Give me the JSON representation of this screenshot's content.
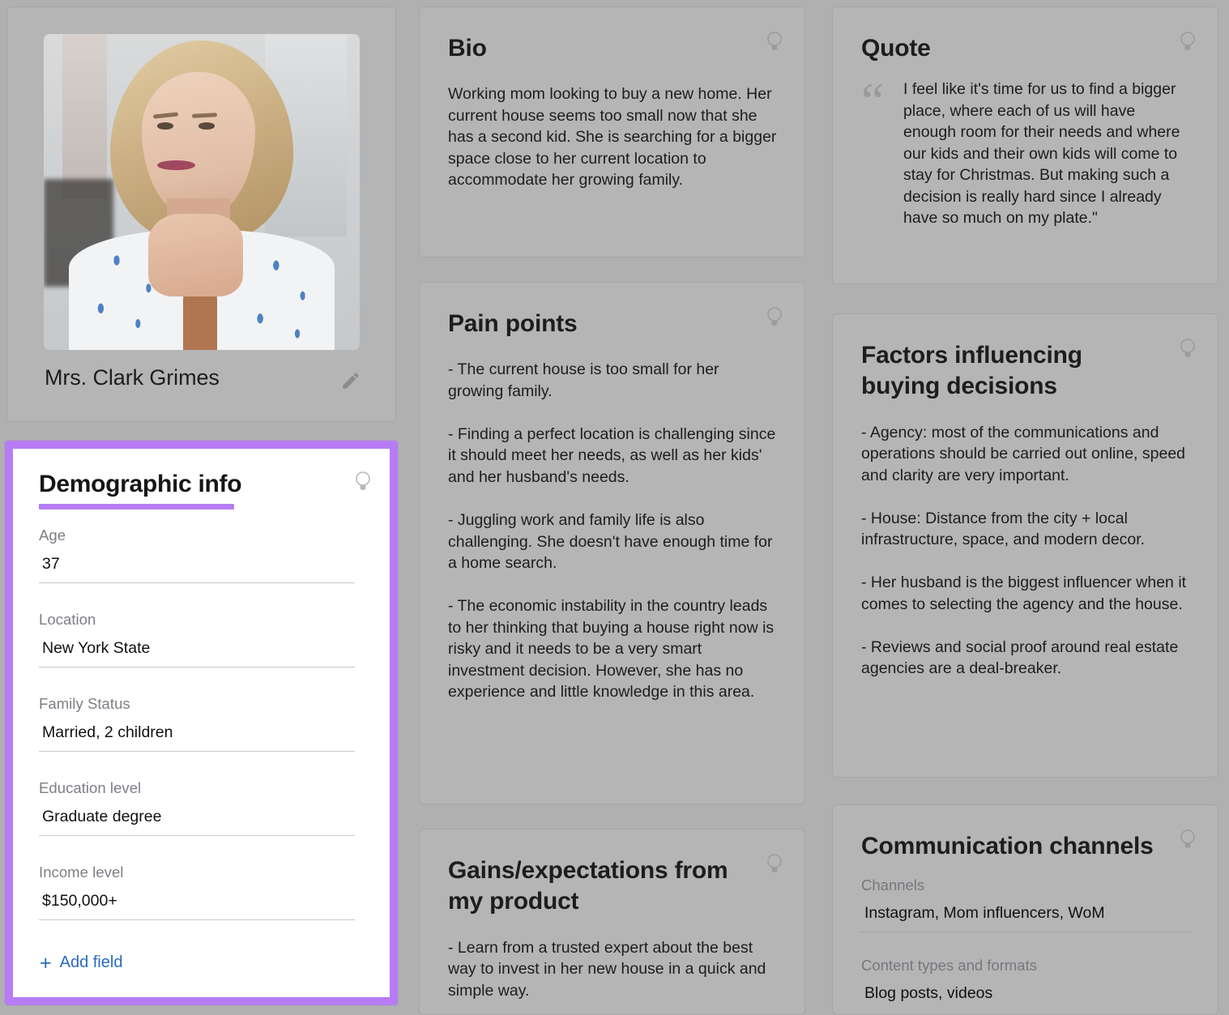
{
  "theme": {
    "page_background": "#b0b0b0",
    "card_background": "#b5b5b5",
    "highlight_purple": "#b77cf5",
    "link_blue": "#2a6bbd"
  },
  "profile": {
    "name": "Mrs. Clark Grimes",
    "photo_alt": "Blonde woman in white floral blouse resting chin on hands",
    "edit_icon": "pencil-icon"
  },
  "demographic": {
    "title": "Demographic info",
    "hint_icon": "lightbulb-icon",
    "fields": [
      {
        "label": "Age",
        "value": "37"
      },
      {
        "label": "Location",
        "value": "New York State"
      },
      {
        "label": "Family Status",
        "value": "Married, 2 children"
      },
      {
        "label": "Education level",
        "value": "Graduate degree"
      },
      {
        "label": "Income level",
        "value": "$150,000+"
      }
    ],
    "add_field_label": "Add field",
    "add_field_icon": "plus-icon"
  },
  "bio": {
    "title": "Bio",
    "hint_icon": "lightbulb-icon",
    "text": "Working mom looking to buy a new home. Her current house seems too small now that she has a second kid. She is searching for a bigger space close to her current location to accommodate her growing family."
  },
  "pain_points": {
    "title": "Pain points",
    "hint_icon": "lightbulb-icon",
    "text": "- The current house is too small for her growing family.\n\n- Finding a perfect location is challenging since it should meet her needs, as well as her kids' and her husband's needs.\n\n- Juggling work and family life is also challenging. She doesn't have enough time for a home search.\n\n- The economic instability in the country leads to her thinking that buying a house right now is risky and it needs to be a very smart investment decision. However, she has no experience and little knowledge in this area."
  },
  "gains": {
    "title": "Gains/expectations from my product",
    "hint_icon": "lightbulb-icon",
    "text": "- Learn from a trusted expert about the best way to invest in her new house in a quick and simple way."
  },
  "quote": {
    "title": "Quote",
    "hint_icon": "lightbulb-icon",
    "quote_mark": "“",
    "text": "I feel like it's time for us to find a bigger place, where each of us will have enough room for their needs and where our kids and their own kids will come to stay for Christmas. But making such a decision is really hard since I already have so much on my plate.\""
  },
  "factors": {
    "title": "Factors influencing buying decisions",
    "hint_icon": "lightbulb-icon",
    "text": "- Agency: most of the communications and operations should be carried out online, speed and clarity are very important.\n\n- House: Distance from the city + local infrastructure, space, and modern decor.\n\n- Her husband is the biggest influencer when it comes to selecting the agency and the house.\n\n- Reviews and social proof around real estate agencies are a deal-breaker."
  },
  "channels": {
    "title": "Communication channels",
    "hint_icon": "lightbulb-icon",
    "fields": [
      {
        "label": "Channels",
        "value": "Instagram, Mom influencers, WoM"
      },
      {
        "label": "Content types and formats",
        "value": "Blog posts, videos"
      }
    ]
  }
}
